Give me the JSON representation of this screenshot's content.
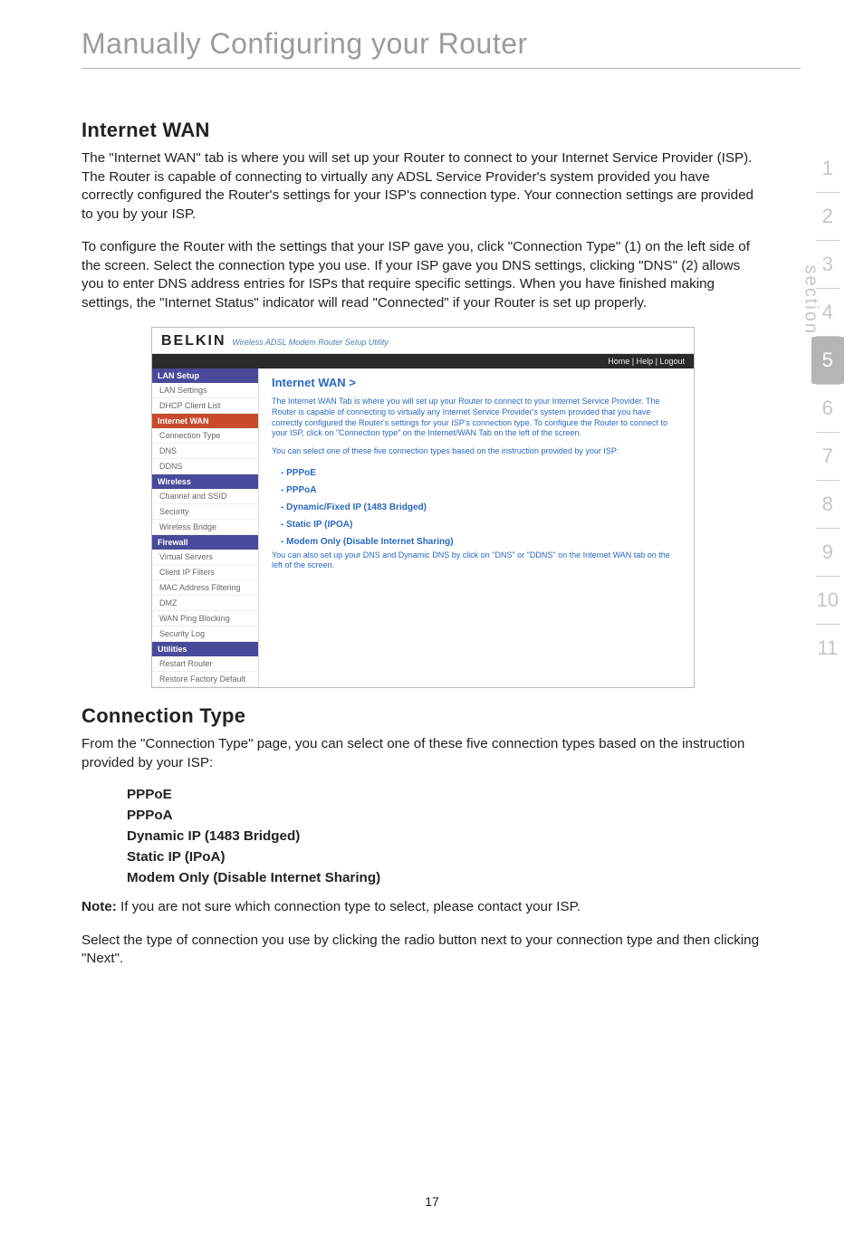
{
  "page_title": "Manually Configuring your Router",
  "section1": {
    "heading": "Internet WAN",
    "para1": "The \"Internet WAN\" tab is where you will set up your Router to connect to your Internet Service Provider (ISP). The Router is capable of connecting to virtually any ADSL Service Provider's system provided you have correctly configured the Router's settings for your ISP's connection type. Your connection settings are provided to you by your ISP.",
    "para2": "To configure the Router with the settings that your ISP gave you, click \"Connection Type\" (1) on the left side of the screen. Select the connection type you use. If your ISP gave you DNS settings, clicking \"DNS\" (2) allows you to enter DNS address entries for ISPs that require specific settings. When you have finished making settings, the \"Internet Status\" indicator will read \"Connected\" if your Router is set up properly."
  },
  "screenshot": {
    "logo": "BELKIN",
    "logo_sub": "Wireless ADSL Modem Router Setup Utility",
    "topbar": "Home | Help | Logout",
    "side_groups": [
      {
        "cat": "LAN Setup",
        "active": false,
        "items": [
          "LAN Settings",
          "DHCP Client List"
        ]
      },
      {
        "cat": "Internet WAN",
        "active": true,
        "items": [
          "Connection Type",
          "DNS",
          "DDNS"
        ]
      },
      {
        "cat": "Wireless",
        "active": false,
        "items": [
          "Channel and SSID",
          "Security",
          "Wireless Bridge"
        ]
      },
      {
        "cat": "Firewall",
        "active": false,
        "items": [
          "Virtual Servers",
          "Client IP Filters",
          "MAC Address Filtering",
          "DMZ",
          "WAN Ping Blocking",
          "Security Log"
        ]
      },
      {
        "cat": "Utilities",
        "active": false,
        "items": [
          "Restart Router",
          "Restore Factory Default"
        ]
      }
    ],
    "main_heading": "Internet WAN >",
    "main_intro": "The Internet WAN Tab is where you will set up your Router to connect to your Internet Service Provider. The Router is capable of connecting to virtually any Internet Service Provider's system provided that you have correctly configured the Router's settings for your ISP's connection type. To configure the Router to connect to your ISP, click on \"Connection type\" on the Internet/WAN Tab on the left of the screen.",
    "main_sub": "You can select one of these five connection types based on the instruction provided by your ISP:",
    "options": [
      "PPPoE",
      "PPPoA",
      "Dynamic/Fixed IP (1483 Bridged)",
      "Static IP (IPOA)",
      "Modem Only (Disable Internet Sharing)"
    ],
    "main_foot": "You can also set up your DNS and Dynamic DNS by click on \"DNS\" or \"DDNS\" on the Internet WAN tab on the left of the screen."
  },
  "section2": {
    "heading": "Connection Type",
    "para1": "From the \"Connection Type\" page, you can select one of these five connection types based on the instruction provided by your ISP:",
    "list": [
      "PPPoE",
      "PPPoA",
      "Dynamic IP (1483 Bridged)",
      "Static IP (IPoA)",
      "Modem Only (Disable Internet Sharing)"
    ],
    "note_label": "Note:",
    "note": " If you are not sure which connection type to select, please contact your ISP.",
    "para2": "Select the type of connection you use by clicking the radio button next to your connection type and then clicking \"Next\"."
  },
  "sidebar_nums": [
    "1",
    "2",
    "3",
    "4",
    "5",
    "6",
    "7",
    "8",
    "9",
    "10",
    "11"
  ],
  "sidebar_active": "5",
  "sidebar_label": "section",
  "page_number": "17"
}
